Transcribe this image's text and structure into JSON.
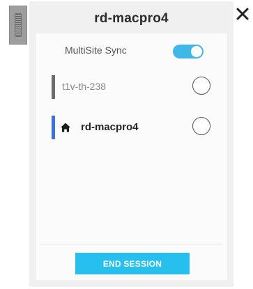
{
  "panel": {
    "title": "rd-macpro4"
  },
  "sync": {
    "label": "MultiSite Sync",
    "enabled": true
  },
  "sites": [
    {
      "name": "t1v-th-238",
      "bar_color": "#6b6b6b",
      "is_home": false,
      "selected": false
    },
    {
      "name": "rd-macpro4",
      "bar_color": "#3d73d9",
      "is_home": true,
      "selected": false
    }
  ],
  "actions": {
    "end_session_label": "END SESSION"
  },
  "icons": {
    "close": "close-icon",
    "drag": "drag-handle-icon",
    "home": "home-icon"
  },
  "colors": {
    "accent": "#27c0ee",
    "toggle_on": "#3fb8e8"
  }
}
